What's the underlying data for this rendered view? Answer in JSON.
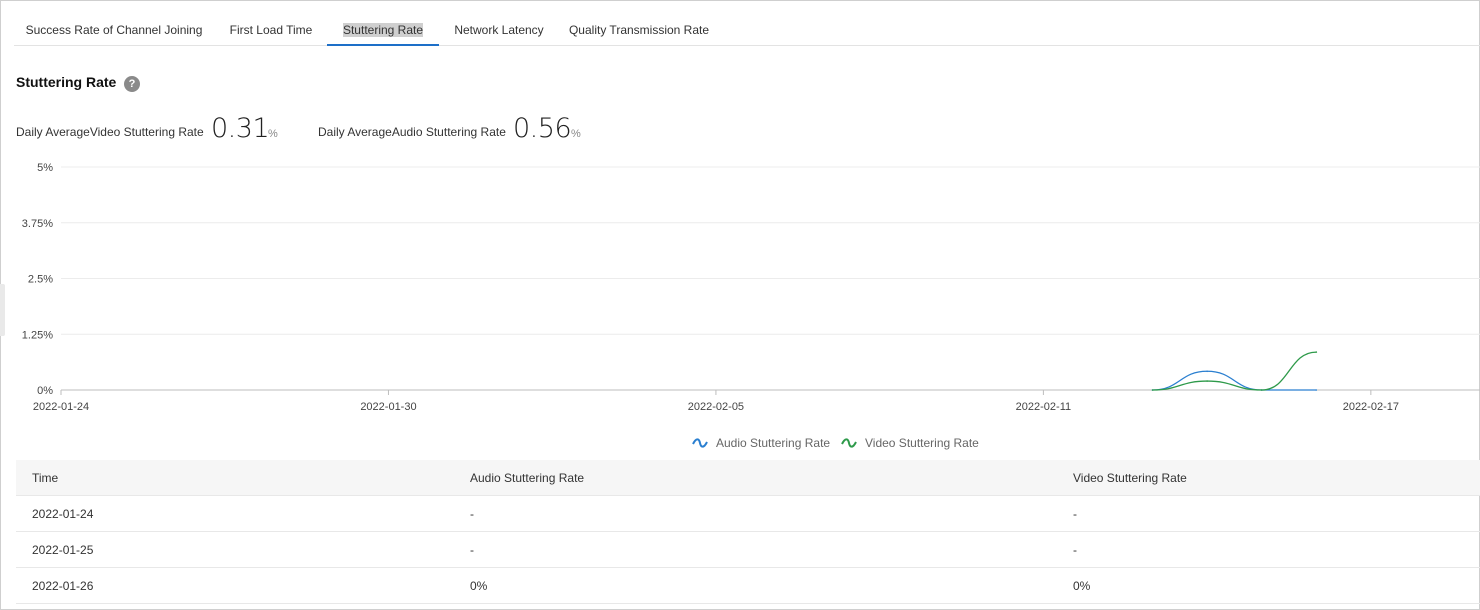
{
  "tabs": [
    {
      "label": "Success Rate of Channel Joining",
      "active": false
    },
    {
      "label": "First Load Time",
      "active": false
    },
    {
      "label": "Stuttering Rate",
      "active": true
    },
    {
      "label": "Network Latency",
      "active": false
    },
    {
      "label": "Quality Transmission Rate",
      "active": false
    }
  ],
  "section": {
    "title": "Stuttering Rate",
    "help_icon": "question-circle-icon"
  },
  "metrics": {
    "video": {
      "label": "Daily AverageVideo Stuttering Rate",
      "value": "0.31",
      "unit": "%"
    },
    "audio": {
      "label": "Daily AverageAudio Stuttering Rate",
      "value": "0.56",
      "unit": "%"
    }
  },
  "colors": {
    "accent": "#1d6fc8",
    "audio_series": "#2a7fd0",
    "video_series": "#2e9a4a"
  },
  "chart_data": {
    "type": "line",
    "x_tick_labels": [
      "2022-01-24",
      "2022-01-30",
      "2022-02-05",
      "2022-02-11",
      "2022-02-17"
    ],
    "x_start": "2022-01-24",
    "x_end": "2022-02-19",
    "y_tick_labels": [
      "0%",
      "1.25%",
      "2.5%",
      "3.75%",
      "5%"
    ],
    "ylim": [
      0,
      5
    ],
    "grid": true,
    "legend_position": "bottom-center",
    "series": [
      {
        "name": "Audio Stuttering Rate",
        "points": [
          [
            "2022-02-13",
            0
          ],
          [
            "2022-02-14",
            0.42
          ],
          [
            "2022-02-15",
            0
          ],
          [
            "2022-02-16",
            0
          ]
        ]
      },
      {
        "name": "Video Stuttering Rate",
        "points": [
          [
            "2022-02-13",
            0
          ],
          [
            "2022-02-14",
            0.2
          ],
          [
            "2022-02-15",
            0
          ],
          [
            "2022-02-16",
            0.85
          ]
        ]
      }
    ]
  },
  "table": {
    "headers": [
      "Time",
      "Audio Stuttering Rate",
      "Video Stuttering Rate"
    ],
    "rows": [
      [
        "2022-01-24",
        "-",
        "-"
      ],
      [
        "2022-01-25",
        "-",
        "-"
      ],
      [
        "2022-01-26",
        "0%",
        "0%"
      ]
    ]
  }
}
